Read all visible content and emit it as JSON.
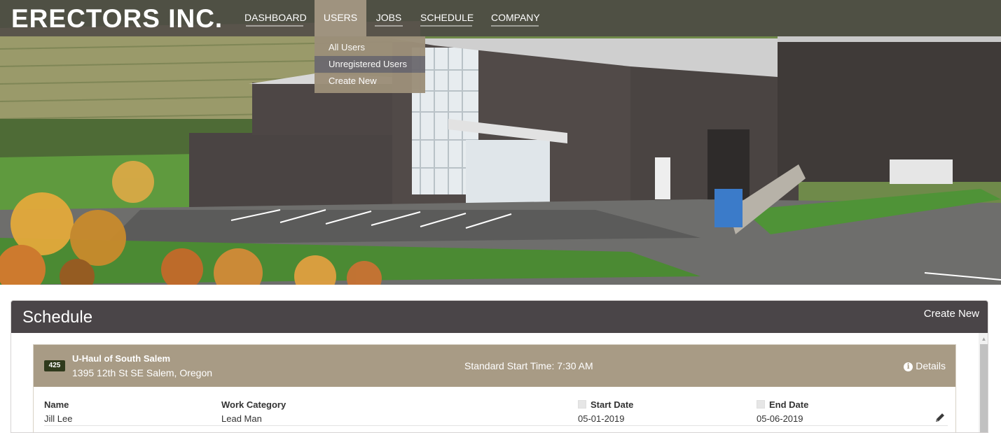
{
  "nav": {
    "brand": "ERECTORS INC.",
    "items": [
      "DASHBOARD",
      "USERS",
      "JOBS",
      "SCHEDULE",
      "COMPANY"
    ],
    "active": "USERS",
    "dropdown": [
      "All Users",
      "Unregistered Users",
      "Create New"
    ],
    "dropdown_hover": "Unregistered Users"
  },
  "schedule": {
    "title": "Schedule",
    "create_label": "Create New",
    "job": {
      "number": "425",
      "name": "U-Haul of South Salem",
      "address": "1395 12th St SE Salem, Oregon",
      "start_time": "Standard Start Time: 7:30 AM",
      "details_label": "Details",
      "columns": [
        "Name",
        "Work Category",
        "Start Date",
        "End Date"
      ],
      "rows": [
        {
          "name": "Jill Lee",
          "category": "Lead Man",
          "start": "05-01-2019",
          "end": "05-06-2019"
        }
      ]
    }
  },
  "colors": {
    "nav_bg": "#464042",
    "active_tab": "#9f937f",
    "panel_header": "#4a4548",
    "job_header": "#a89b85",
    "badge": "#2f3a1c"
  },
  "icons": [
    "info-circle-icon",
    "pencil-icon",
    "checkbox-icon",
    "scroll-up-arrow-icon"
  ]
}
